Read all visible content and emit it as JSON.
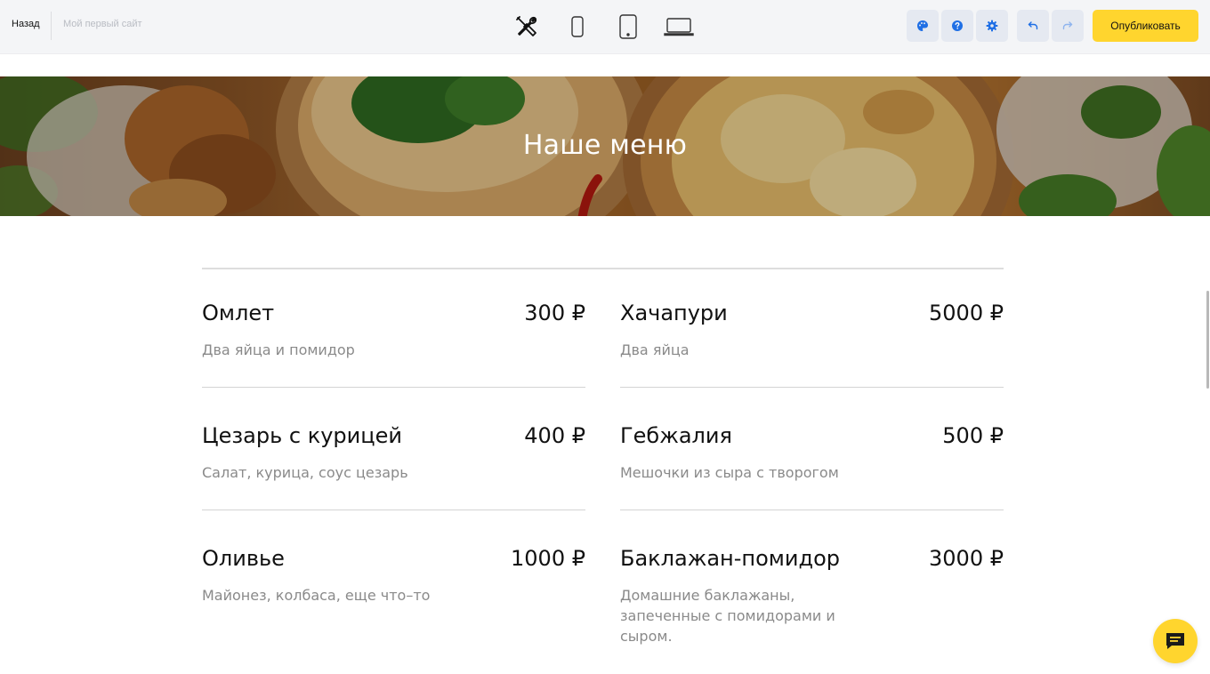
{
  "toolbar": {
    "back_label": "Назад",
    "site_name": "Мой первый сайт",
    "publish_label": "Опубликовать",
    "device_icons": [
      "tools-icon",
      "phone-icon",
      "tablet-icon",
      "laptop-icon"
    ],
    "action_icons": [
      "palette-icon",
      "help-icon",
      "settings-icon",
      "undo-icon",
      "redo-icon"
    ],
    "colors": {
      "accent": "#ffd52e",
      "icon_blue": "#1f6fe5",
      "bar_bg": "#f4f5f7"
    }
  },
  "hero": {
    "title": "Наше меню"
  },
  "menu": {
    "items": [
      {
        "name": "Омлет",
        "price": "300 ₽",
        "description": "Два яйца и помидор"
      },
      {
        "name": "Хачапури",
        "price": "5000 ₽",
        "description": "Два яйца"
      },
      {
        "name": "Цезарь с курицей",
        "price": "400 ₽",
        "description": "Салат, курица, соус цезарь"
      },
      {
        "name": "Гебжалия",
        "price": "500 ₽",
        "description": "Мешочки из сыра с творогом"
      },
      {
        "name": "Оливье",
        "price": "1000 ₽",
        "description": "Майонез, колбаса, еще что–то"
      },
      {
        "name": "Баклажан-помидор",
        "price": "3000 ₽",
        "description": "Домашние баклажаны, запеченные с помидорами и сыром."
      }
    ]
  },
  "chat": {
    "icon": "chat-icon"
  }
}
